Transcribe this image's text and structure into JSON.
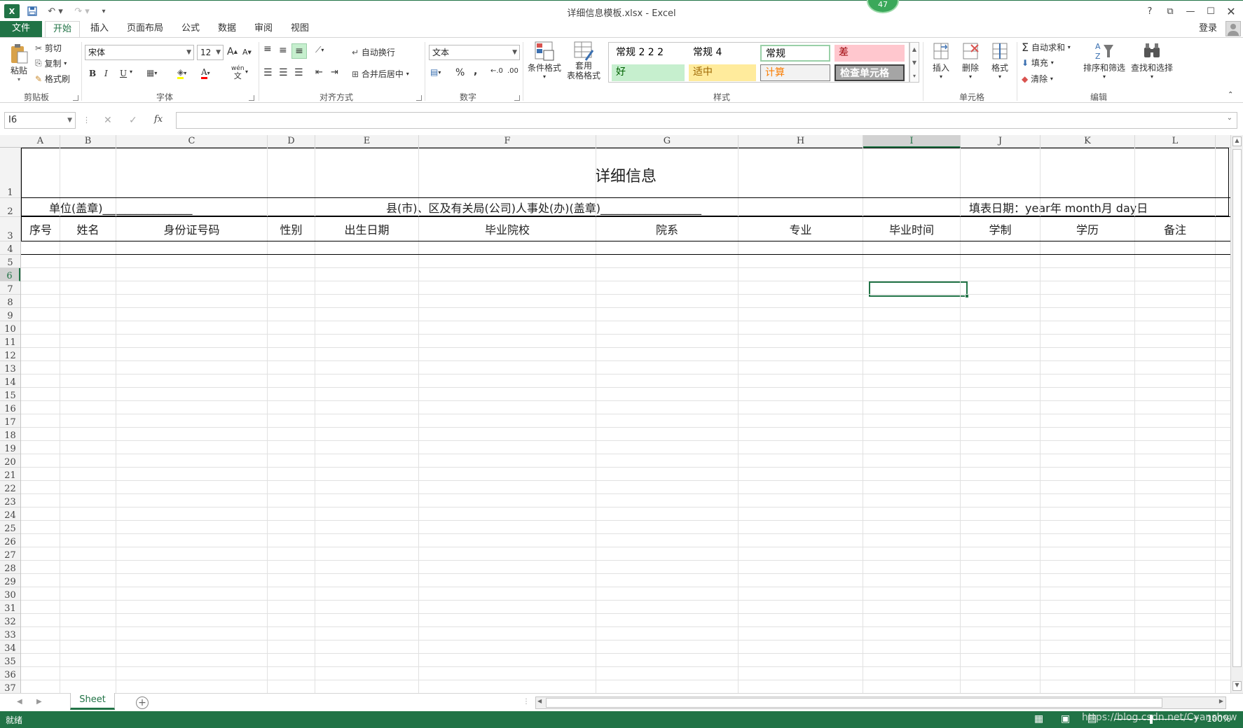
{
  "window": {
    "title": "详细信息模板.xlsx - Excel",
    "badge": "47",
    "help": "?",
    "signin": "登录"
  },
  "tabs": {
    "file": "文件",
    "home": "开始",
    "insert": "插入",
    "page_layout": "页面布局",
    "formulas": "公式",
    "data": "数据",
    "review": "审阅",
    "view": "视图"
  },
  "ribbon": {
    "clipboard": {
      "label": "剪贴板",
      "paste": "粘贴",
      "cut": "剪切",
      "copy": "复制",
      "format_painter": "格式刷"
    },
    "font": {
      "label": "字体",
      "name": "宋体",
      "size": "12",
      "grow": "A",
      "shrink": "A",
      "bold": "B",
      "italic": "I",
      "underline": "U",
      "font_color": "A",
      "phonetic_top": "wén",
      "phonetic_bottom": "文"
    },
    "alignment": {
      "label": "对齐方式",
      "wrap": "自动换行",
      "merge": "合并后居中"
    },
    "number": {
      "label": "数字",
      "format": "文本",
      "percent": "%",
      "comma": ","
    },
    "styles": {
      "label": "样式",
      "conditional": "条件格式",
      "table_line1": "套用",
      "table_line2": "表格格式",
      "cells": [
        {
          "text": "常规 2 2 2",
          "bg": "#ffffff",
          "color": "#000000"
        },
        {
          "text": "常规 4",
          "bg": "#ffffff",
          "color": "#000000"
        },
        {
          "text": "常规",
          "bg": "#ffffff",
          "color": "#000000"
        },
        {
          "text": "差",
          "bg": "#ffc7ce",
          "color": "#9c0006"
        },
        {
          "text": "好",
          "bg": "#c6efce",
          "color": "#006100"
        },
        {
          "text": "适中",
          "bg": "#ffeb9c",
          "color": "#9c6500"
        },
        {
          "text": "计算",
          "bg": "#f2f2f2",
          "color": "#fa7d00"
        },
        {
          "text": "检查单元格",
          "bg": "#a5a5a5",
          "color": "#ffffff"
        }
      ]
    },
    "cells": {
      "label": "单元格",
      "insert": "插入",
      "delete": "删除",
      "format": "格式"
    },
    "editing": {
      "label": "编辑",
      "autosum": "自动求和",
      "fill": "填充",
      "clear": "清除",
      "sort": "排序和筛选",
      "find": "查找和选择"
    }
  },
  "formula_bar": {
    "name_box": "I6",
    "cancel": "✕",
    "enter": "✓",
    "fx": "fx",
    "value": ""
  },
  "columns": [
    "A",
    "B",
    "C",
    "D",
    "E",
    "F",
    "G",
    "H",
    "I",
    "J",
    "K",
    "L"
  ],
  "rows": [
    "1",
    "2",
    "3",
    "4",
    "5",
    "6",
    "7",
    "8",
    "9",
    "10",
    "11",
    "12",
    "13",
    "14",
    "15",
    "16",
    "17",
    "18",
    "19",
    "20",
    "21",
    "22",
    "23",
    "24",
    "25",
    "26",
    "27",
    "28",
    "29",
    "30",
    "31",
    "32",
    "33",
    "34",
    "35",
    "36",
    "37"
  ],
  "sheet": {
    "title": "详细信息",
    "row2_left": "单位(盖章)________________",
    "row2_mid": "县(市)、区及有关局(公司)人事处(办)(盖章)__________________",
    "row2_right": "填表日期：year年 month月 day日",
    "headers": [
      "序号",
      "姓名",
      "身份证号码",
      "性别",
      "出生日期",
      "毕业院校",
      "院系",
      "专业",
      "毕业时间",
      "学制",
      "学历",
      "备注"
    ]
  },
  "sheet_tab": "Sheet",
  "status": {
    "ready": "就绪",
    "zoom": "100%",
    "watermark": "https://blog.csdn.net/Cyanshow"
  }
}
